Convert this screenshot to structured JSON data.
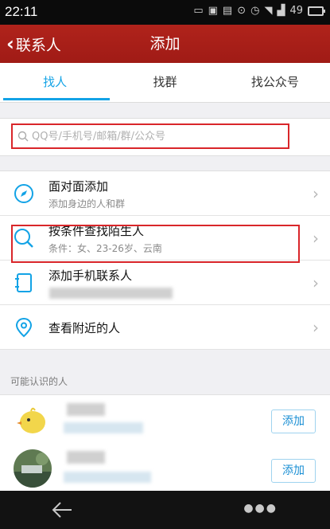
{
  "status_bar": {
    "time": "22:11",
    "battery": "49"
  },
  "header": {
    "back_label": "联系人",
    "title": "添加"
  },
  "tabs": [
    {
      "label": "找人",
      "active": true
    },
    {
      "label": "找群",
      "active": false
    },
    {
      "label": "找公众号",
      "active": false
    }
  ],
  "search": {
    "placeholder": "QQ号/手机号/邮箱/群/公众号",
    "value": ""
  },
  "menu": [
    {
      "title": "面对面添加",
      "subtitle": "添加身边的人和群",
      "icon": "compass-icon"
    },
    {
      "title": "按条件查找陌生人",
      "subtitle": "条件：女、23-26岁、云南",
      "icon": "search-icon"
    },
    {
      "title": "添加手机联系人",
      "subtitle": "",
      "icon": "phone-contacts-icon"
    },
    {
      "title": "查看附近的人",
      "subtitle": "",
      "icon": "location-icon"
    }
  ],
  "people_section": {
    "label": "可能认识的人"
  },
  "people": [
    {
      "add_label": "添加"
    },
    {
      "add_label": "添加"
    }
  ],
  "colors": {
    "accent": "#13a3e6",
    "header": "#a81f18",
    "highlight": "#d9262a"
  }
}
